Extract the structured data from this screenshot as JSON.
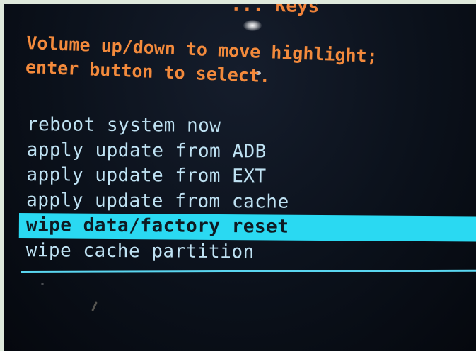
{
  "header": {
    "title_partial": "... Keys"
  },
  "instructions": {
    "line1": "Volume up/down to move highlight;",
    "line2": "enter button to select."
  },
  "menu": {
    "items": [
      {
        "label": "reboot system now",
        "selected": false
      },
      {
        "label": "apply update from ADB",
        "selected": false
      },
      {
        "label": "apply update from EXT",
        "selected": false
      },
      {
        "label": "apply update from cache",
        "selected": false
      },
      {
        "label": "wipe data/factory reset",
        "selected": true
      },
      {
        "label": "wipe cache partition",
        "selected": false
      }
    ]
  },
  "colors": {
    "background": "#0b111b",
    "instruction_text": "#f38a3c",
    "menu_text": "#bfe2f3",
    "highlight": "#2ad9f2",
    "highlight_text": "#0e1a22",
    "divider": "#5ad6f0"
  }
}
